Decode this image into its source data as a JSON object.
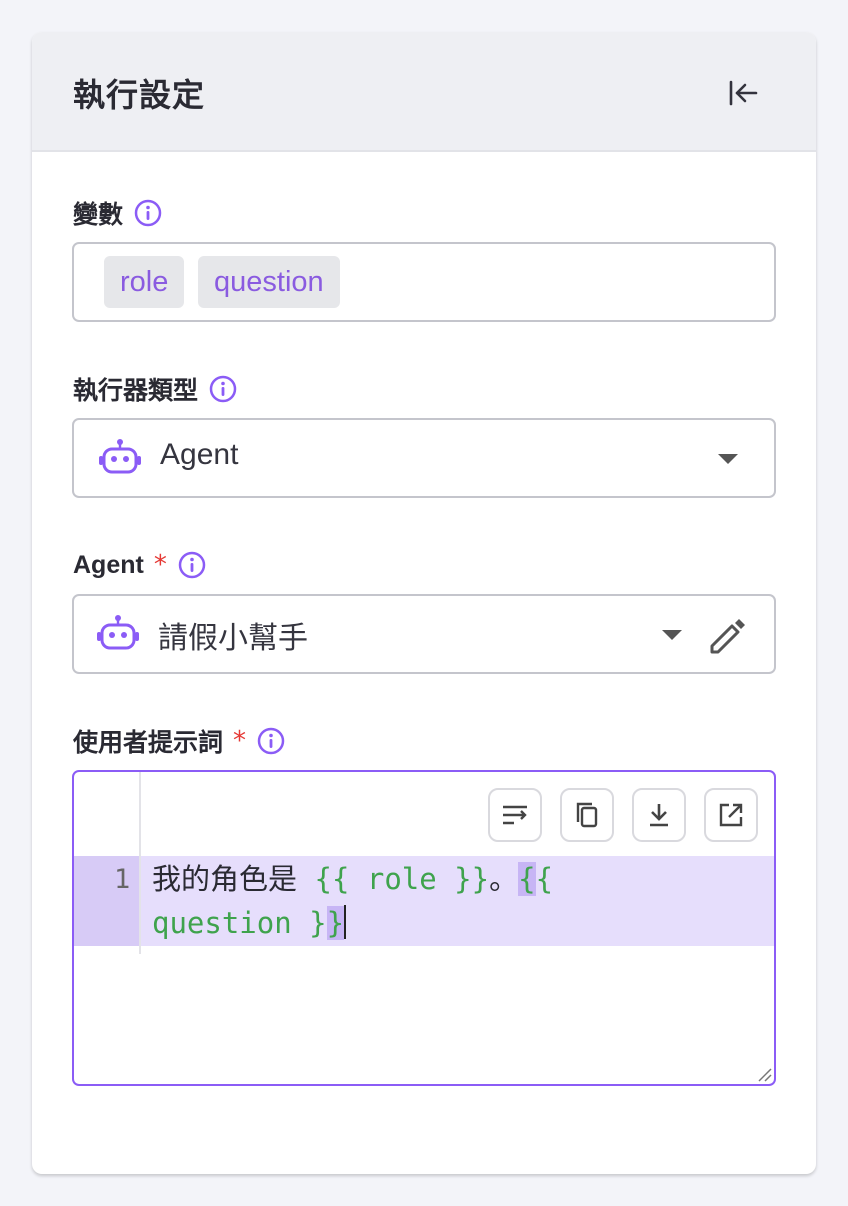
{
  "panel": {
    "title": "執行設定"
  },
  "variables": {
    "label": "變數",
    "chips": [
      "role",
      "question"
    ]
  },
  "executor_type": {
    "label": "執行器類型",
    "value": "Agent",
    "icon": "robot-icon"
  },
  "agent": {
    "label": "Agent",
    "required_mark": "*",
    "value": "請假小幫手",
    "icon": "robot-icon"
  },
  "user_prompt": {
    "label": "使用者提示詞",
    "required_mark": "*",
    "line_number": "1",
    "text_prefix": "我的角色是",
    "var1": "{{ role }}",
    "sep": "。",
    "var2_open": "{{",
    "var2_rest": "question }",
    "var2_close": "}"
  },
  "colors": {
    "accent": "#8b5cf6",
    "required": "#e53935",
    "variable_token": "#3fa34d"
  }
}
